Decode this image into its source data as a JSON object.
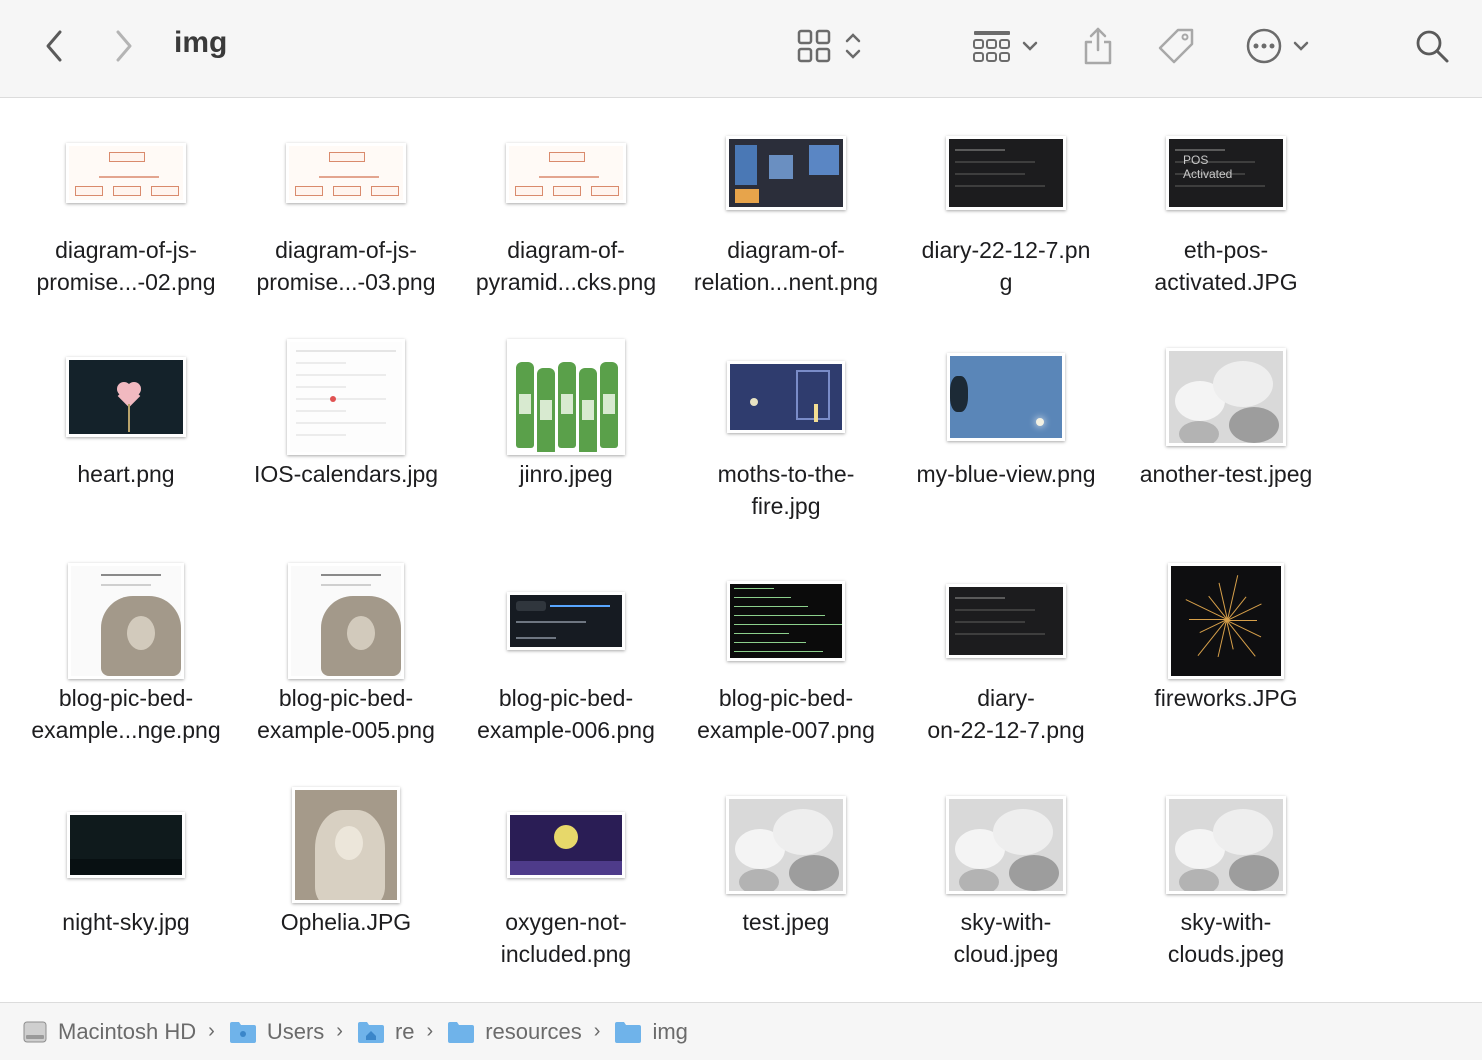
{
  "window": {
    "title": "img"
  },
  "toolbar": {
    "back_icon": "chevron-left-icon",
    "forward_icon": "chevron-right-icon",
    "view_icon": "grid-view-icon",
    "group_icon": "group-by-icon",
    "share_icon": "share-icon",
    "tag_icon": "tag-icon",
    "more_icon": "ellipsis-circle-icon",
    "search_icon": "search-icon"
  },
  "files": [
    {
      "name": "diagram-of-js-\npromise...-02.png",
      "thumb": "diagram"
    },
    {
      "name": "diagram-of-js-\npromise...-03.png",
      "thumb": "diagram"
    },
    {
      "name": "diagram-of-\npyramid...cks.png",
      "thumb": "diagram"
    },
    {
      "name": "diagram-of-\nrelation...nent.png",
      "thumb": "darkblue"
    },
    {
      "name": "diary-22-12-7.pn\ng",
      "thumb": "dark"
    },
    {
      "name": "eth-pos-\nactivated.JPG",
      "thumb": "dark",
      "thumb_text": "POS\nActivated"
    },
    {
      "name": "heart.png",
      "thumb": "heart"
    },
    {
      "name": "IOS-calendars.jpg",
      "thumb": "cal"
    },
    {
      "name": "jinro.jpeg",
      "thumb": "jinro"
    },
    {
      "name": "moths-to-the-\nfire.jpg",
      "thumb": "moths"
    },
    {
      "name": "my-blue-view.png",
      "thumb": "blue"
    },
    {
      "name": "another-test.jpeg",
      "thumb": "cloud"
    },
    {
      "name": "blog-pic-bed-\nexample...nge.png",
      "thumb": "blog"
    },
    {
      "name": "blog-pic-bed-\nexample-005.png",
      "thumb": "blog"
    },
    {
      "name": "blog-pic-bed-\nexample-006.png",
      "thumb": "gh"
    },
    {
      "name": "blog-pic-bed-\nexample-007.png",
      "thumb": "term"
    },
    {
      "name": "diary-\non-22-12-7.png",
      "thumb": "dark"
    },
    {
      "name": "fireworks.JPG",
      "thumb": "fire"
    },
    {
      "name": "night-sky.jpg",
      "thumb": "night"
    },
    {
      "name": "Ophelia.JPG",
      "thumb": "ophelia"
    },
    {
      "name": "oxygen-not-\nincluded.png",
      "thumb": "oni"
    },
    {
      "name": "test.jpeg",
      "thumb": "cloud"
    },
    {
      "name": "sky-with-\ncloud.jpeg",
      "thumb": "cloud"
    },
    {
      "name": "sky-with-\nclouds.jpeg",
      "thumb": "cloud"
    }
  ],
  "pathbar": {
    "items": [
      {
        "label": "Macintosh HD",
        "icon": "hard-drive-icon"
      },
      {
        "label": "Users",
        "icon": "folder-icon"
      },
      {
        "label": "re",
        "icon": "home-folder-icon"
      },
      {
        "label": "resources",
        "icon": "folder-icon"
      },
      {
        "label": "img",
        "icon": "folder-icon"
      }
    ],
    "separator": "›"
  }
}
